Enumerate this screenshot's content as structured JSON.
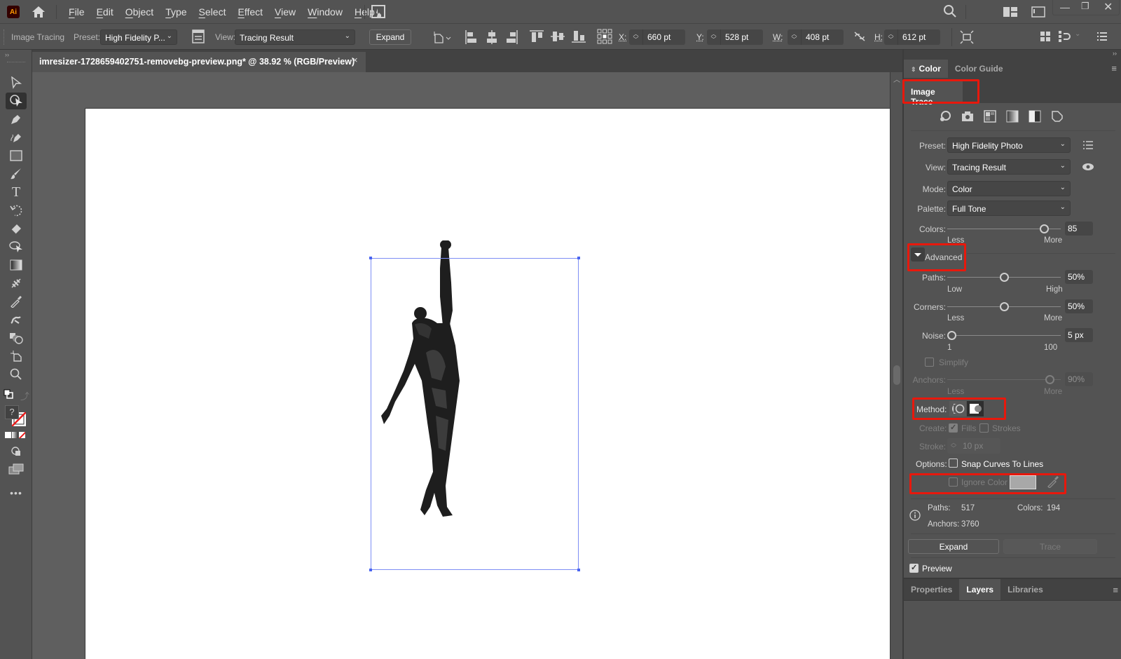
{
  "app": {
    "logo": "Ai"
  },
  "menu": {
    "items": [
      "File",
      "Edit",
      "Object",
      "Type",
      "Select",
      "Effect",
      "View",
      "Window",
      "Help"
    ]
  },
  "control_bar": {
    "mode_label": "Image Tracing",
    "preset_label": "Preset:",
    "preset_value": "High Fidelity P...",
    "view_label": "View:",
    "view_value": "Tracing Result",
    "expand_label": "Expand",
    "x_label": "X:",
    "x_value": "660 pt",
    "y_label": "Y:",
    "y_value": "528 pt",
    "w_label": "W:",
    "w_value": "408 pt",
    "h_label": "H:",
    "h_value": "612 pt"
  },
  "document": {
    "tab_title": "imresizer-1728659402751-removebg-preview.png* @ 38.92 % (RGB/Preview)",
    "close_glyph": "×"
  },
  "panel_top": {
    "tabs": [
      {
        "label": "Color",
        "active": true
      },
      {
        "label": "Color Guide",
        "active": false
      }
    ]
  },
  "image_trace": {
    "title": "Image Trace",
    "preset_label": "Preset:",
    "preset_value": "High Fidelity Photo",
    "view_label": "View:",
    "view_value": "Tracing Result",
    "mode_label": "Mode:",
    "mode_value": "Color",
    "palette_label": "Palette:",
    "palette_value": "Full Tone",
    "colors_label": "Colors:",
    "colors_value": "85",
    "colors_min": "Less",
    "colors_max": "More",
    "colors_fraction": 0.85,
    "advanced_label": "Advanced",
    "paths_label": "Paths:",
    "paths_value": "50%",
    "paths_min": "Low",
    "paths_max": "High",
    "paths_fraction": 0.5,
    "corners_label": "Corners:",
    "corners_value": "50%",
    "corners_min": "Less",
    "corners_max": "More",
    "corners_fraction": 0.5,
    "noise_label": "Noise:",
    "noise_value": "5 px",
    "noise_min": "1",
    "noise_max": "100",
    "noise_fraction": 0.04,
    "simplify_label": "Simplify",
    "simplify_checked": false,
    "anchors_label": "Anchors:",
    "anchors_value": "90%",
    "anchors_min": "Less",
    "anchors_max": "More",
    "anchors_fraction": 0.9,
    "method_label": "Method:",
    "method_options": [
      "Abutting",
      "Overlapping"
    ],
    "method_selected": "Overlapping",
    "create_label": "Create:",
    "fills_label": "Fills",
    "fills_checked": true,
    "strokes_label": "Strokes",
    "strokes_checked": false,
    "stroke_label": "Stroke:",
    "stroke_value": "10 px",
    "options_label": "Options:",
    "snap_label": "Snap Curves To Lines",
    "snap_checked": false,
    "ignore_color_label": "Ignore Color",
    "ignore_color_checked": false,
    "ignore_color_swatch": "#a8a8a8",
    "stats": {
      "paths_label": "Paths:",
      "paths_value": "517",
      "colors_label": "Colors:",
      "colors_value": "194",
      "anchors_label": "Anchors:",
      "anchors_value": "3760"
    },
    "expand_label": "Expand",
    "trace_label": "Trace",
    "preview_label": "Preview",
    "preview_checked": true
  },
  "panel_bottom": {
    "tabs": [
      {
        "label": "Properties",
        "active": false
      },
      {
        "label": "Layers",
        "active": true
      },
      {
        "label": "Libraries",
        "active": false
      }
    ]
  },
  "colors": {
    "highlight_red": "#e8180c",
    "selection_blue": "#7d8ef5"
  }
}
